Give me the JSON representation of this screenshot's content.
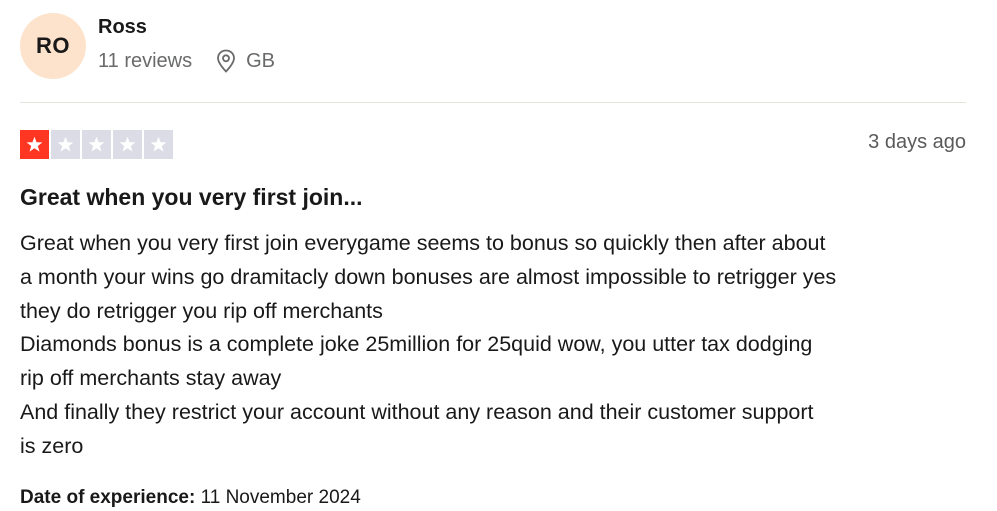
{
  "reviewer": {
    "initials": "RO",
    "name": "Ross",
    "reviews_count": "11 reviews",
    "location": "GB",
    "avatar_color": "#fde3cb"
  },
  "review": {
    "rating": 1,
    "max_rating": 5,
    "star_filled_color": "#ff3722",
    "star_empty_color": "#dcdce6",
    "timestamp": "3 days ago",
    "title": "Great when you very first join...",
    "body_lines": [
      "Great when you very first join everygame seems to bonus so quickly then after about",
      "a month your wins go dramitacly down bonuses are almost impossible to retrigger yes",
      "they do retrigger you rip off merchants",
      "Diamonds bonus is a complete joke 25million for 25quid wow, you utter tax dodging",
      "rip off merchants stay away",
      "And finally they restrict your account without any reason and their customer support",
      "is zero"
    ],
    "experience_label": "Date of experience:",
    "experience_date": "11 November 2024"
  }
}
